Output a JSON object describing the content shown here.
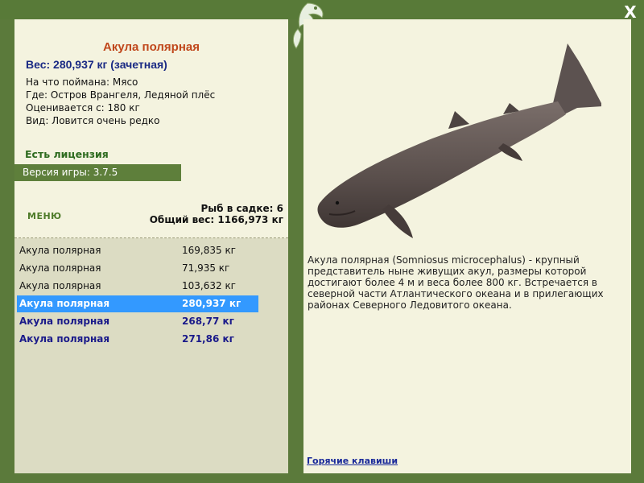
{
  "close_label": "X",
  "fish": {
    "name": "Акула полярная",
    "weight_line": "Вес: 280,937 кг (зачетная)",
    "bait": "На что поймана: Мясо",
    "place": "Где: Остров Врангеля, Ледяной плёс",
    "valued_from": "Оценивается с: 180 кг",
    "kind": "Вид: Ловится очень редко"
  },
  "license": "Есть лицензия",
  "version": "Версия игры: 3.7.5",
  "menu_label": "МЕНЮ",
  "stats": {
    "fish_in_keepnet": "Рыб в садке: 6",
    "total_weight": "Общий вес: 1166,973 кг"
  },
  "catch_list": [
    {
      "name": "Акула полярная",
      "weight": "169,835 кг",
      "style": "normal"
    },
    {
      "name": "Акула полярная",
      "weight": "71,935 кг",
      "style": "normal"
    },
    {
      "name": "Акула полярная",
      "weight": "103,632 кг",
      "style": "normal"
    },
    {
      "name": "Акула полярная",
      "weight": "280,937 кг",
      "style": "selected"
    },
    {
      "name": "Акула полярная",
      "weight": "268,77 кг",
      "style": "bold"
    },
    {
      "name": "Акула полярная",
      "weight": "271,86 кг",
      "style": "bold"
    }
  ],
  "description": "Акула полярная (Somniosus microcephalus) - крупный представитель ныне живущих акул, размеры которой достигают более 4 м и веса более 800 кг. Встречается в северной части Атлантического океана и в прилегающих районах Северного Ледовитого океана.",
  "hotkeys_label": "Горячие клавиши",
  "icons": {
    "logo": "fish-logo-icon",
    "close": "close-icon"
  },
  "colors": {
    "frame": "#5b7a3b",
    "panel": "#f4f3df",
    "fish_name": "#c0471b",
    "weight": "#1a2a84",
    "selected_row": "#3399ff"
  }
}
